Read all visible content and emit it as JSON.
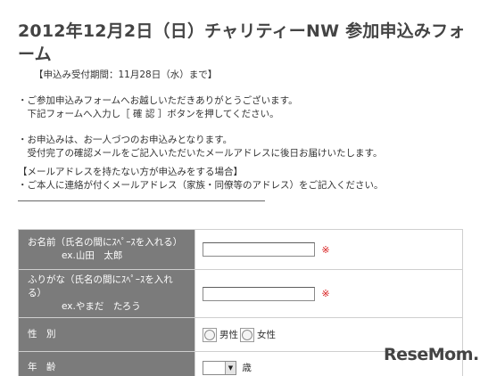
{
  "header": {
    "title_main": "2012年12月2日（日）チャリティーNW 参加申込みフォーム"
  },
  "notice": "【申込み受付期間：11月28日（水）まで】",
  "paragraphs": {
    "p1_line1": "・ご参加申込みフォームへお越しいただきありがとうございます。",
    "p1_line2": "　下記フォームへ入力し［ 確 認 ］ボタンを押してください。",
    "p2_line1": "・お申込みは、お一人づつのお申込みとなります。",
    "p2_line2": "　受付完了の確認メールをご記入いただいたメールアドレスに後日お届けいたします。",
    "p3_line1": "【メールアドレスを持たない方が申込みをする場合】",
    "p3_line2": "・ご本人に連絡が付くメールアドレス（家族・同僚等のアドレス）をご記入ください。"
  },
  "form": {
    "name": {
      "label_line1": "お名前（氏名の間にｽﾍﾟｰｽを入れる）",
      "label_example": "ex.山田　太郎",
      "value": "",
      "required_mark": "※"
    },
    "furigana": {
      "label_line1": "ふりがな（氏名の間にｽﾍﾟｰｽを入れる）",
      "label_example": "ex.やまだ　たろう",
      "value": "",
      "required_mark": "※"
    },
    "gender": {
      "label": "性　別",
      "options": [
        "男性",
        "女性"
      ],
      "selected": ""
    },
    "age": {
      "label": "年　齢",
      "selected": "",
      "unit": "歳"
    }
  },
  "logo": {
    "text_a": "Rese",
    "text_b": "M",
    "text_c": "m."
  },
  "colors": {
    "label_bg": "#7b7b7b",
    "required": "#d81b1b",
    "title": "#444444"
  }
}
